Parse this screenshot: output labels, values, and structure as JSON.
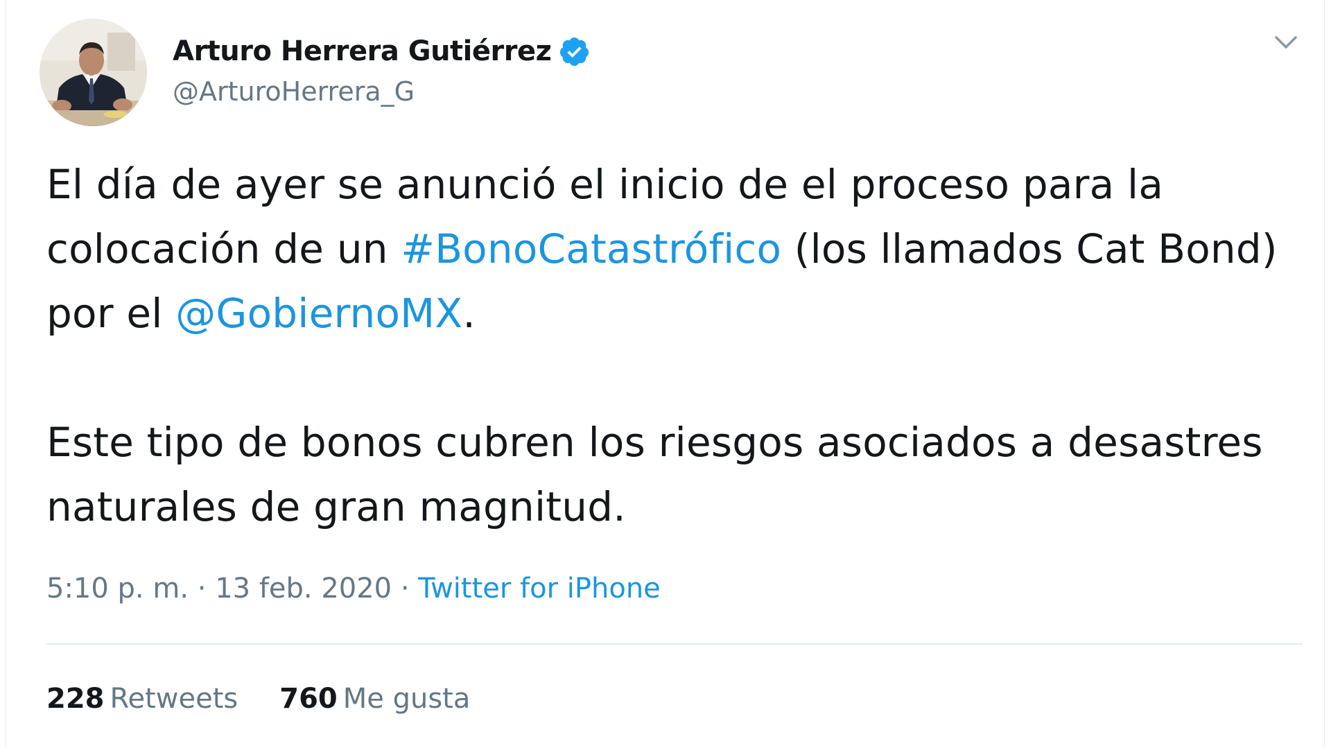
{
  "tweet": {
    "author": {
      "display_name": "Arturo Herrera Gutiérrez",
      "handle": "@ArturoHerrera_G",
      "verified": true
    },
    "paragraphs": [
      {
        "p1_text_1": "El día de ayer se anunció el inicio de el proceso para la colocación de un ",
        "hashtag": "#BonoCatastrófico",
        "p1_text_2": " (los llamados Cat Bond) por el ",
        "mention": "@GobiernoMX",
        "p1_text_3": "."
      },
      {
        "text": "Este tipo de bonos cubren los riesgos asociados a desastres naturales de gran magnitud."
      }
    ],
    "time": "5:10 p. m.",
    "separator": "·",
    "date": "13 feb. 2020",
    "source": "Twitter for iPhone",
    "stats": {
      "retweets_count": "228",
      "retweets_label": "Retweets",
      "likes_count": "760",
      "likes_label": "Me gusta"
    }
  },
  "colors": {
    "link": "#1b95e0",
    "secondary_text": "#657786",
    "primary_text": "#14171a",
    "verified_badge": "#1da1f2",
    "divider": "#e6ecf0"
  },
  "icons": {
    "verified": "verified-badge-icon",
    "caret": "chevron-down-icon"
  }
}
